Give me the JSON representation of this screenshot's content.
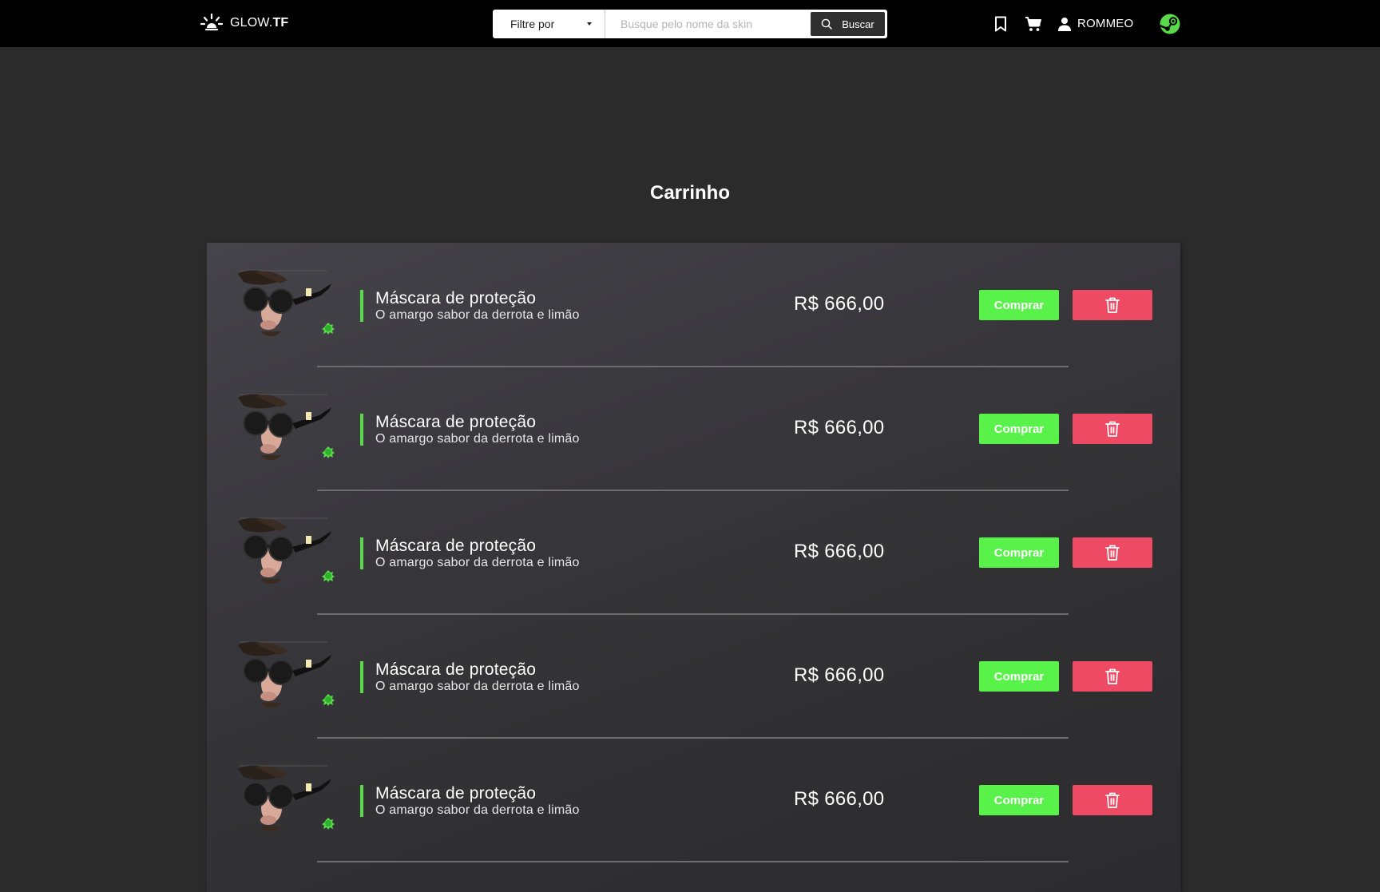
{
  "header": {
    "logo_text": "GLOW.",
    "logo_text_bold": "TF",
    "filter_label": "Filtre por",
    "search_placeholder": "Busque pelo nome da skin",
    "search_button": "Buscar",
    "username": "ROMMEO"
  },
  "main": {
    "title": "Carrinho"
  },
  "cart": {
    "items": [
      {
        "name": "Máscara de proteção",
        "description": "O amargo sabor da derrota e limão",
        "price": "R$ 666,00",
        "buy_label": "Comprar"
      },
      {
        "name": "Máscara de proteção",
        "description": "O amargo sabor da derrota e limão",
        "price": "R$ 666,00",
        "buy_label": "Comprar"
      },
      {
        "name": "Máscara de proteção",
        "description": "O amargo sabor da derrota e limão",
        "price": "R$ 666,00",
        "buy_label": "Comprar"
      },
      {
        "name": "Máscara de proteção",
        "description": "O amargo sabor da derrota e limão",
        "price": "R$ 666,00",
        "buy_label": "Comprar"
      },
      {
        "name": "Máscara de proteção",
        "description": "O amargo sabor da derrota e limão",
        "price": "R$ 666,00",
        "buy_label": "Comprar"
      }
    ]
  },
  "colors": {
    "background": "#2b2b2b",
    "topbar": "#000000",
    "buy_button": "#59f24a",
    "delete_button": "#ef4a64",
    "item_accent": "#5ad94a"
  },
  "icons": {
    "logo": "sunrise-logo-icon",
    "search": "search-icon",
    "bookmark": "bookmark-icon",
    "cart": "shopping-cart-icon",
    "user": "user-icon",
    "steam": "steam-icon",
    "delete": "trash-icon"
  }
}
